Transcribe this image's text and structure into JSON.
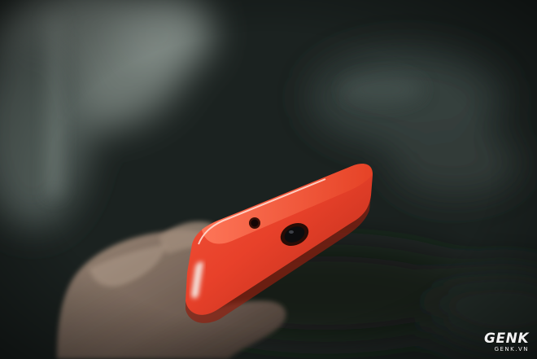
{
  "watermark": {
    "brand": "GENK",
    "domain": "GENK.VN"
  },
  "colors": {
    "phone_body": "#e8412a",
    "phone_highlight": "#ff6a4e",
    "background_dark": "#1c2220",
    "background_light": "#5e6964",
    "skin": "#8a7666"
  },
  "subject": {
    "icons": [
      "headphone-jack-icon",
      "camera-lens-icon",
      "volume-button"
    ]
  }
}
